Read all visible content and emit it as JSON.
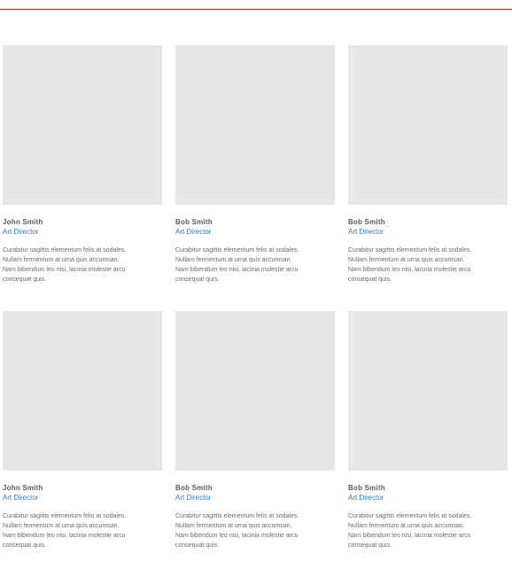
{
  "colors": {
    "rule": "#c9302c",
    "photo_placeholder": "#e7e7e7",
    "name_text": "#5a5a5a",
    "role_text": "#2a7ae2",
    "bio_text": "#6b6b6b"
  },
  "team": {
    "rows": [
      {
        "cards": [
          {
            "name": "John Smith",
            "role": "Art Director",
            "bio": "Curabitur sagittis elementum felis at sodales. Nullam fermentum at urna quis accumsan. Nam bibendum leo nisi, lacinia molestie arcu consequat quis."
          },
          {
            "name": "Bob Smith",
            "role": "Art Director",
            "bio": "Curabitur sagittis elementum felis at sodales. Nullam fermentum at urna quis accumsan. Nam bibendum leo nisi, lacinia molestie arcu consequat quis."
          },
          {
            "name": "Bob Smith",
            "role": "Art Director",
            "bio": "Curabitur sagittis elementum felis at sodales. Nullam fermentum at urna quis accumsan. Nam bibendum leo nisi, lacinia molestie arcu consequat quis."
          }
        ]
      },
      {
        "cards": [
          {
            "name": "John Smith",
            "role": "Art Director",
            "bio": "Curabitur sagittis elementum felis at sodales. Nullam fermentum at urna quis accumsan. Nam bibendum leo nisi, lacinia molestie arcu consequat quis."
          },
          {
            "name": "Bob Smith",
            "role": "Art Director",
            "bio": "Curabitur sagittis elementum felis at sodales. Nullam fermentum at urna quis accumsan. Nam bibendum leo nisi, lacinia molestie arcu consequat quis."
          },
          {
            "name": "Bob Smith",
            "role": "Art Director",
            "bio": "Curabitur sagittis elementum felis at sodales. Nullam fermentum at urna quis accumsan. Nam bibendum leo nisi, lacinia molestie arcu consequat quis."
          }
        ]
      }
    ]
  }
}
